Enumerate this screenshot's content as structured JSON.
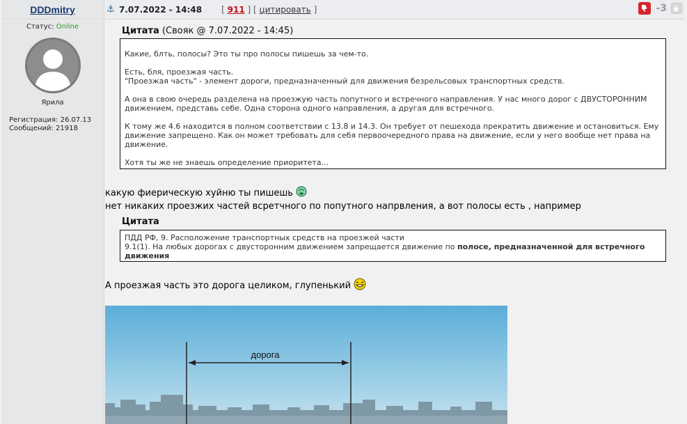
{
  "post": {
    "username": "DDDmitry",
    "date": "7.07.2022 - 14:48",
    "bracket_open": "[",
    "post_number": "911",
    "bracket_mid": "] [",
    "quote_link": "цитировать",
    "bracket_close": "]",
    "rating": "-3"
  },
  "user": {
    "status_label": "Статус:",
    "status_value": "Online",
    "rank": "Ярила",
    "registration": "Регистрация: 26.07.13",
    "messages": "Сообщений: 21918"
  },
  "quote1": {
    "label": "Цитата",
    "meta": "(Свояк @ 7.07.2022 - 14:45)",
    "lines": [
      "Какие, блть, полосы? Это ты про полосы пишешь за чем-то.",
      "Есть, бля, проезжая часть.",
      "\"Проезжая часть\" - элемент дороги, предназначенный для движения безрельсовых транспортных средств.",
      "А она в свою очередь разделена на проезжую часть попутного и встречного направления. У нас много дорог с ДВУСТОРОННИМ движением, представь себе. Одна сторона одного направления, а другая для встречного.",
      "К тому же 4.6 находится в полном соответствии с 13.8 и 14.3. Он требует от пешехода прекратить движение и остановиться. Ему движение запрещено. Как он может требовать для себя первоочередного права на движение, если у него вообще нет права на движение.",
      "Хотя ты же не знаешь определение приоритета..."
    ]
  },
  "reply1": "какую фиерическую хуйню ты пишешь",
  "reply2": "нет никаких проезжих частей всретчного по попутного напрвления, а вот полосы есть , например",
  "quote2": {
    "label": "Цитата",
    "line1": "ПДД РФ, 9. Расположение транспортных средств на проезжей части",
    "line2_normal": "9.1(1). На любых дорогах с двусторонним движением запрещается движение по ",
    "line2_bold": "полосе, предназначенной для встречного движения"
  },
  "reply3": "А проезжая часть это дорога целиком, глупенький",
  "picture": {
    "label": "дорога"
  },
  "colors": {
    "username": "#1a3b75",
    "post_number": "#c1121a",
    "online": "#2a9a2a",
    "thumb_down": "#d8232a"
  }
}
